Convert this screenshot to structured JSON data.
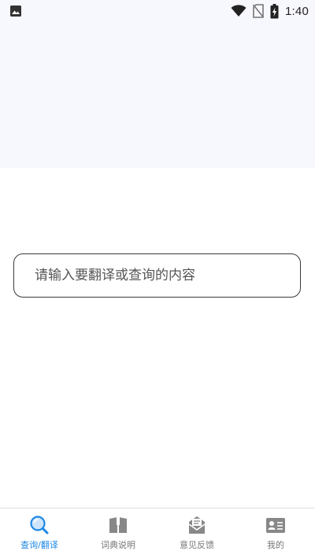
{
  "status_bar": {
    "time": "1:40",
    "icons": [
      "image-notification-icon",
      "wifi-icon",
      "no-sim-icon",
      "battery-charging-icon"
    ]
  },
  "search": {
    "placeholder": "请输入要翻译或查询的内容",
    "value": ""
  },
  "bottom_nav": {
    "active_index": 0,
    "accent_color": "#1e88e5",
    "inactive_color": "#777777",
    "items": [
      {
        "label": "查询/翻译",
        "icon": "search-icon"
      },
      {
        "label": "词典说明",
        "icon": "dictionary-icon"
      },
      {
        "label": "意见反馈",
        "icon": "feedback-mail-icon"
      },
      {
        "label": "我的",
        "icon": "profile-card-icon"
      }
    ]
  },
  "colors": {
    "header_background": "#f7f7fe",
    "page_background": "#ffffff",
    "search_border": "#3a3a3a"
  }
}
